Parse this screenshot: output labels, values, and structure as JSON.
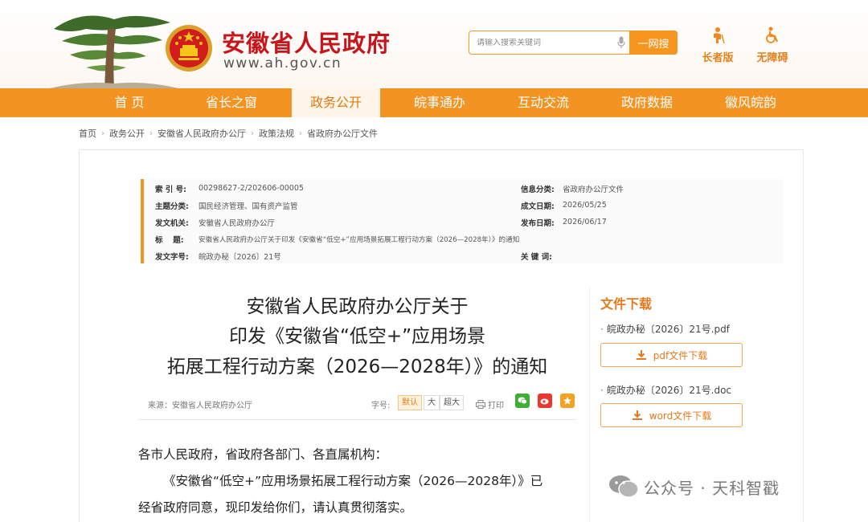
{
  "header": {
    "site_title": "安徽省人民政府",
    "site_url": "www.ah.gov.cn",
    "search": {
      "placeholder": "请输入搜索关键词",
      "button": "一网搜"
    },
    "tools": [
      {
        "icon": "elderly-icon",
        "label": "长者版"
      },
      {
        "icon": "wheelchair-icon",
        "label": "无障碍"
      }
    ]
  },
  "nav": {
    "items": [
      "首 页",
      "省长之窗",
      "政务公开",
      "皖事通办",
      "互动交流",
      "政府数据",
      "徽风皖韵"
    ],
    "active_index": 2
  },
  "breadcrumb": [
    "首页",
    "政务公开",
    "安徽省人民政府办公厅",
    "政策法规",
    "省政府办公厅文件"
  ],
  "meta": {
    "index_label": "索 引 号:",
    "index_value": "00298627-2/202606-00005",
    "info_label": "信息分类:",
    "info_value": "省政府办公厅文件",
    "topic_label": "主题分类:",
    "topic_value": "国民经济管理、国有资产监管",
    "formed_label": "成文日期:",
    "formed_value": "2026/05/25",
    "issuer_label": "发文机关:",
    "issuer_value": "安徽省人民政府办公厅",
    "published_label": "发布日期:",
    "published_value": "2026/06/17",
    "title_label": "标　 题:",
    "title_value": "安徽省人民政府办公厅关于印发《安徽省“低空+”应用场景拓展工程行动方案（2026—2028年）》的通知",
    "docno_label": "发文字号:",
    "docno_value": "皖政办秘〔2026〕21号",
    "keywords_label": "关 键 词:",
    "keywords_value": ""
  },
  "article": {
    "title_lines": [
      "安徽省人民政府办公厅关于",
      "印发《安徽省“低空+”应用场景",
      "拓展工程行动方案（2026—2028年）》的通知"
    ],
    "source": "来源：安徽省人民政府办公厅",
    "font_size_label": "字号:",
    "font_sizes": [
      "默认",
      "大",
      "超大"
    ],
    "print_label": "打印",
    "body": [
      "各市人民政府，省政府各部门、各直属机构：",
      "《安徽省“低空+”应用场景拓展工程行动方案（2026—2028年）》已",
      "经省政府同意，现印发给你们，请认真贯彻落实。"
    ]
  },
  "downloads": {
    "heading": "文件下载",
    "files": [
      {
        "name": "皖政办秘〔2026〕21号.pdf",
        "button": "pdf文件下载"
      },
      {
        "name": "皖政办秘〔2026〕21号.doc",
        "button": "word文件下载"
      }
    ]
  },
  "watermark": {
    "text": "公众号 · 天科智戳"
  },
  "colors": {
    "accent": "#f39322",
    "brand_red": "#c6161c",
    "heading_orange": "#e5791b"
  }
}
